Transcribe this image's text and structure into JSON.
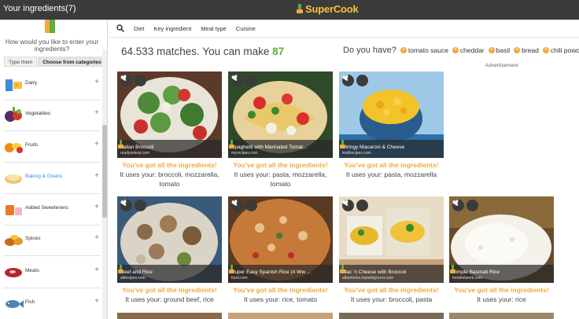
{
  "header": {
    "left_title": "Your ingredients(7)",
    "brand": "SuperCook"
  },
  "sidebar": {
    "question": "How would you like to enter your ingredients?",
    "tabs": [
      {
        "label": "Type them"
      },
      {
        "label": "Choose from categories"
      }
    ],
    "categories": [
      {
        "label": "Dairy",
        "plus": "+"
      },
      {
        "label": "Vegetables",
        "plus": "+"
      },
      {
        "label": "Fruits",
        "plus": "+"
      },
      {
        "label": "Baking & Grains",
        "plus": "+"
      },
      {
        "label": "Added Sweeteners",
        "plus": "+"
      },
      {
        "label": "Spices",
        "plus": "+"
      },
      {
        "label": "Meats",
        "plus": "+"
      },
      {
        "label": "Fish",
        "plus": "+"
      }
    ]
  },
  "filters": [
    "Diet",
    "Key ingredient",
    "Meal type",
    "Cuisine"
  ],
  "results": {
    "prefix": "64.533 matches. You can make",
    "count": "87"
  },
  "do_you_have": {
    "label": "Do you have?",
    "chips": [
      "tomato sauce",
      "cheddar",
      "basil",
      "bread",
      "chili powder"
    ]
  },
  "advertisement_label": "Advertisement",
  "recipes": [
    {
      "name": "Italian Broccoli",
      "source": "readyseteat.com",
      "got": "You've got all the ingredients!",
      "uses": "It uses your: broccoli, mozzarella, tomato"
    },
    {
      "name": "Spaghetti with Marinated Tomat...",
      "source": "myrecipes.com",
      "got": "You've got all the ingredients!",
      "uses": "It uses your: pasta, mozzarella, tomato"
    },
    {
      "name": "Stringy Macaroni & Cheese",
      "source": "kraftrecipes.com",
      "got": "You've got all the ingredients!",
      "uses": "It uses your: pasta, mozzarella"
    },
    {
      "name": "Beef and Rice",
      "source": "allrecipes.com",
      "got": "You've got all the ingredients!",
      "uses": "It uses your: ground beef, rice"
    },
    {
      "name": "Super Easy Spanish Rice (4 Ww ...",
      "source": "food.com",
      "got": "You've got all the ingredients!",
      "uses": "It uses your: rice, tomato"
    },
    {
      "name": "Mac 'n Cheese with Broccoli",
      "source": "albertsons.mywebgrocer.com",
      "got": "You've got all the ingredients!",
      "uses": "It uses your: broccoli, pasta"
    },
    {
      "name": "Simple Basmati Rice",
      "source": "foodnetwork.com",
      "got": "You've got all the ingredients!",
      "uses": "It uses your: rice"
    }
  ],
  "colors": {
    "accent_green": "#5fae3a",
    "accent_orange": "#f2a93b",
    "link_blue": "#3a8dde",
    "topbar": "#3b3b3b"
  }
}
